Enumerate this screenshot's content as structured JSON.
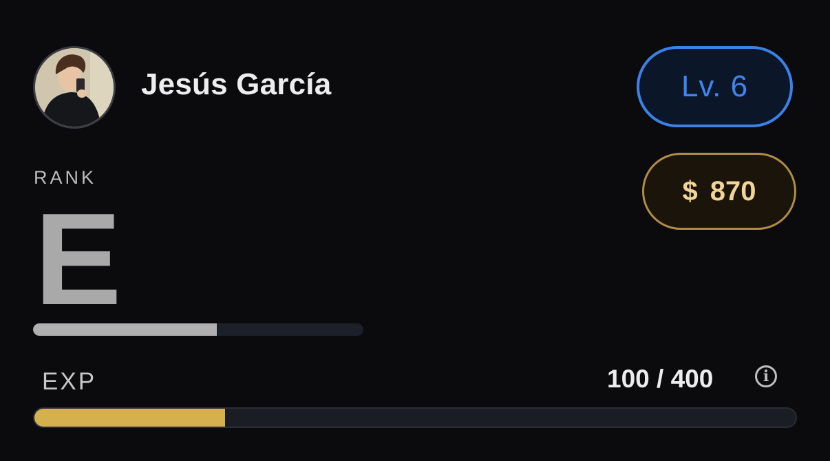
{
  "profile": {
    "name": "Jesús García",
    "level_label": "Lv. 6",
    "money_symbol": "$",
    "money_amount": "870"
  },
  "rank": {
    "label": "RANK",
    "value": "E",
    "progress_fraction": 0.557,
    "bar_color": "#b0b0b0"
  },
  "exp": {
    "label": "EXP",
    "value_text": "100 / 400",
    "current": 100,
    "max": 400,
    "bar_color": "#d4b04e",
    "info_icon": "info-icon"
  },
  "colors": {
    "background": "#0b0b0e",
    "level_accent": "#3b82e6",
    "money_accent": "#b08d45"
  }
}
